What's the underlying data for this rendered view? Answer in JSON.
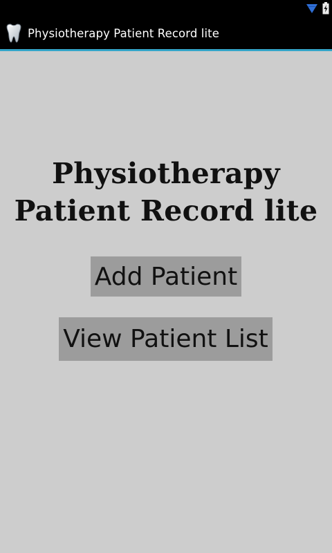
{
  "app": {
    "title": "Physiotherapy Patient Record lite",
    "icon": "tooth-icon"
  },
  "status_bar": {
    "icons": [
      "wifi-icon",
      "battery-charging-icon"
    ]
  },
  "main": {
    "heading_line1": "Physiotherapy",
    "heading_line2": "Patient Record lite",
    "buttons": [
      {
        "label": "Add Patient"
      },
      {
        "label": "View Patient List"
      }
    ]
  },
  "colors": {
    "background": "#cdcdcd",
    "action_bar": "#000000",
    "accent": "#34a5c8",
    "button": "#9c9c9c",
    "wifi": "#2f6fd6"
  }
}
